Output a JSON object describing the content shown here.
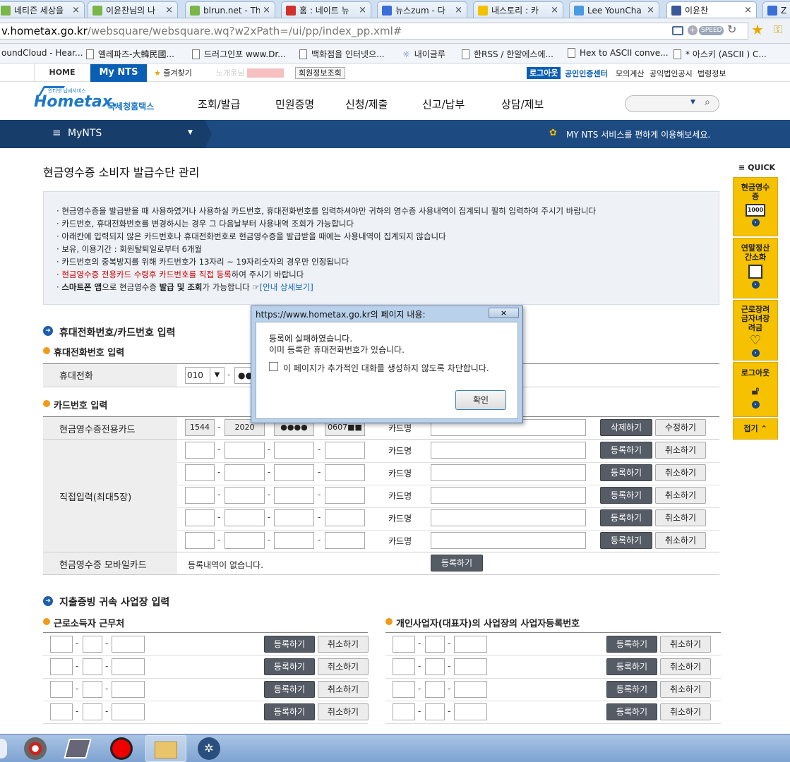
{
  "browser": {
    "tabs": [
      {
        "title": "네티즌 세상을",
        "color": "#7ab648"
      },
      {
        "title": "이윤찬님의 나",
        "color": "#7ab648"
      },
      {
        "title": "blrun.net - Th",
        "color": "#7ab648"
      },
      {
        "title": "홈 : 네이트 뉴",
        "color": "#d0312d"
      },
      {
        "title": "뉴스zum - 다",
        "color": "#3a6fd8"
      },
      {
        "title": "내스토리 : 카",
        "color": "#f2c200"
      },
      {
        "title": "Lee YounCha",
        "color": "#4a9be0"
      },
      {
        "title": "이윤찬",
        "color": "#3b5998"
      },
      {
        "title": "Z",
        "color": "#3a6fd8"
      }
    ],
    "url_host": "v.hometax.go.kr",
    "url_path": "/websquare/websquare.wq?w2xPath=/ui/pp/index_pp.xml#",
    "speed_label": "SPEED",
    "bookmarks": [
      "oundCloud - Hear...",
      "엘레파즈-大韓民國...",
      "드러그인포 www.Dr...",
      "백화점을 인터넷으...",
      "내이글루",
      "한RSS / 한알에스에...",
      "Hex to ASCII conve...",
      "* 아스키 (ASCII ) C..."
    ]
  },
  "topbar": {
    "home": "HOME",
    "mynts": "My NTS",
    "favorites": "즐겨찾기",
    "user_name": "노개윤님",
    "member_info": "회원정보조회",
    "logout": "로그아웃",
    "cert_center": "공인인증센터",
    "links": [
      "모의계산",
      "공익법인공시",
      "법령정보"
    ]
  },
  "header": {
    "logo_small": "인터넷 납세서비스",
    "logo_main": "Hometax.",
    "logo_sub": "국세청홈택스",
    "menu": [
      "조회/발급",
      "민원증명",
      "신청/제출",
      "신고/납부",
      "상담/제보"
    ]
  },
  "mynts_bar": {
    "title": "MyNTS",
    "notice": "MY NTS 서비스를 편하게 이용해보세요."
  },
  "page": {
    "title": "현금영수증 소비자 발급수단 관리",
    "notices": [
      "현금영수증을 발급받을 때 사용하였거나 사용하실 카드번호, 휴대전화번호를 입력하셔야만 귀하의 영수증 사용내역이 집계되니 필히 입력하여 주시기 바랍니다",
      "카드번호, 휴대전화번호를 변경하시는 경우 그 다음날부터 사용내역 조회가 가능합니다",
      "아래칸에 입력되지 않은 카드번호나 휴대전화번호로 현금영수증을 발급받을 때에는 사용내역이 집계되지 않습니다",
      "보유, 이용기간 : 회원탈퇴일로부터 6개월",
      "카드번호의 중복방지를 위해 카드번호가 13자리 ~ 19자리숫자의 경우만 인정됩니다"
    ],
    "notice_red": "현금영수증 전용카드 수령후 카드번호를 직접 등록",
    "notice_red_tail": "하여 주시기 바랍니다",
    "notice_last_pre": "스마트폰 앱",
    "notice_last_mid1": "으로 현금영수증 ",
    "notice_last_bold1": "발급 및 조회",
    "notice_last_mid2": "가 가능합니다 ",
    "notice_link": "[안내 상세보기]",
    "sec1_title": "휴대전화번호/카드번호 입력",
    "phone_sub": "휴대전화번호 입력",
    "phone_label": "휴대전화",
    "phone_prefix": "010",
    "phone_mask": "●●",
    "card_sub": "카드번호 입력",
    "card_row_label": "현금영수증전용카드",
    "card_fixed": [
      "1544",
      "2020",
      "●●●●",
      "0607■■"
    ],
    "card_name_label": "카드명",
    "delete_btn": "삭제하기",
    "modify_btn": "수정하기",
    "direct_label": "직접입력(최대5장)",
    "register_btn": "등록하기",
    "cancel_btn": "취소하기",
    "mobile_label": "현금영수증 모바일카드",
    "mobile_none": "등록내역이 없습니다.",
    "sec2_title": "지출증빙 귀속 사업장 입력",
    "worker_sub": "근로소득자 근무처",
    "biz_sub": "개인사업자(대표자)의 사업장의 사업자등록번호"
  },
  "quick": {
    "title": "QUICK",
    "items": [
      "현금영수증",
      "연말정산간소화",
      "근로장려금자녀장려금",
      "로그아웃"
    ],
    "collapse": "접기"
  },
  "dialog": {
    "title": "https://www.hometax.go.kr의 페이지 내용:",
    "line1": "등록에 실패하였습니다.",
    "line2": "이미 등록한 휴대전화번호가 있습니다.",
    "checkbox": "이 페이지가 추가적인 대화를 생성하지 않도록 차단합니다.",
    "ok": "확인"
  },
  "colors": {
    "accent": "#1d4a80",
    "button_dark": "#555c66",
    "quick": "#f6c200",
    "red_text": "#cc0000",
    "tab_active": "#0a5fb4"
  }
}
